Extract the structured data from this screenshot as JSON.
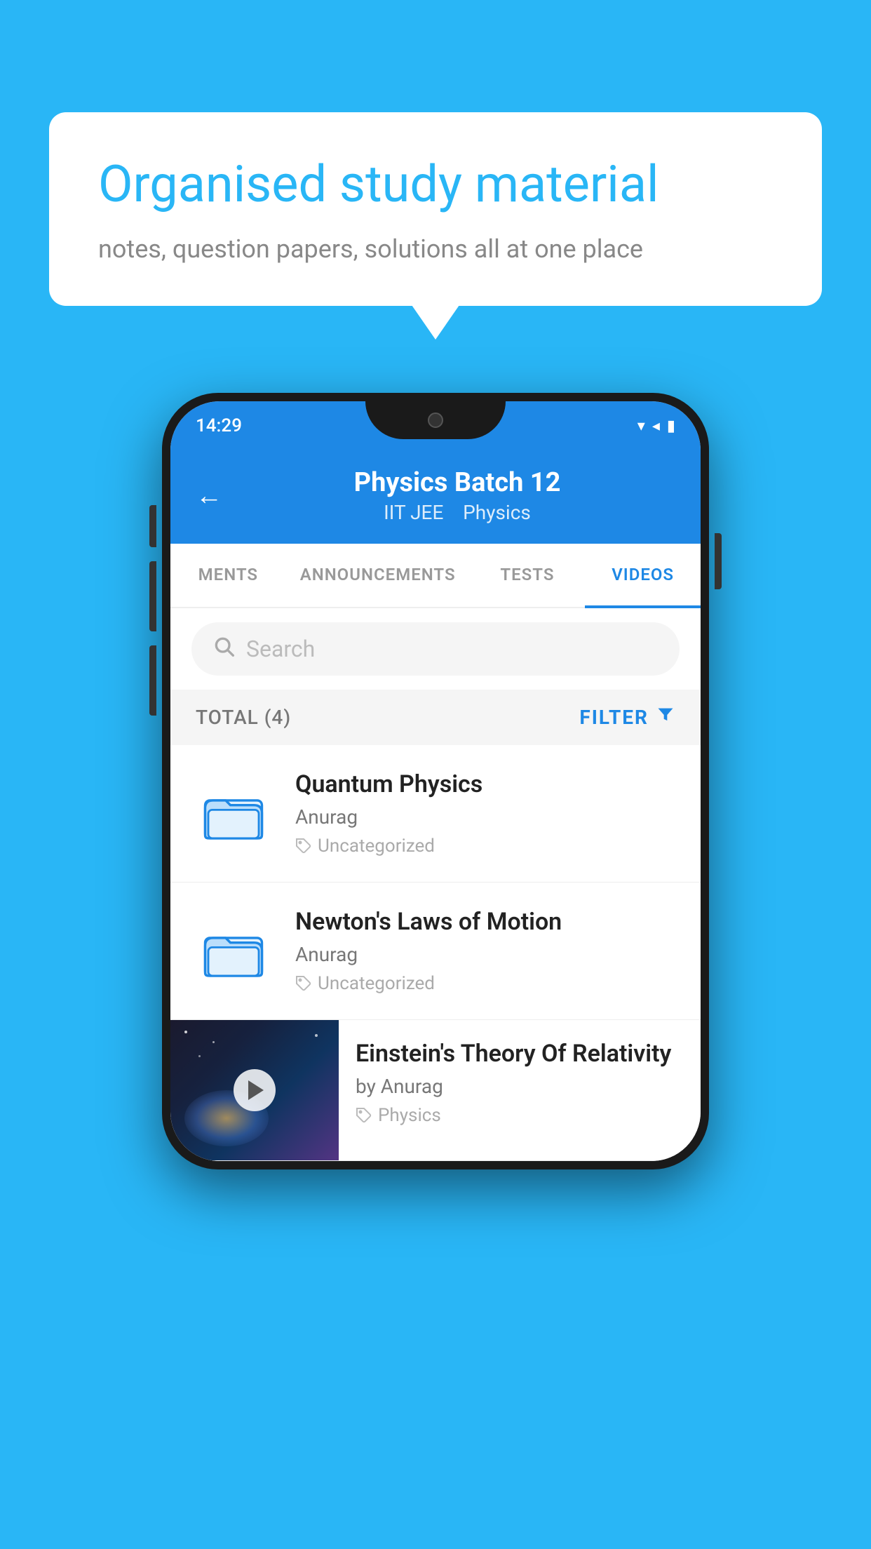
{
  "background_color": "#29b6f6",
  "bubble": {
    "title": "Organised study material",
    "subtitle": "notes, question papers, solutions all at one place"
  },
  "status_bar": {
    "time": "14:29",
    "icons": "▾ ◂ ▮"
  },
  "app_header": {
    "back_label": "←",
    "title": "Physics Batch 12",
    "subtitle_part1": "IIT JEE",
    "subtitle_part2": "Physics"
  },
  "tabs": [
    {
      "label": "MENTS",
      "active": false
    },
    {
      "label": "ANNOUNCEMENTS",
      "active": false
    },
    {
      "label": "TESTS",
      "active": false
    },
    {
      "label": "VIDEOS",
      "active": true
    }
  ],
  "search": {
    "placeholder": "Search"
  },
  "filter_row": {
    "total_label": "TOTAL (4)",
    "filter_label": "FILTER"
  },
  "videos": [
    {
      "title": "Quantum Physics",
      "author": "Anurag",
      "tag": "Uncategorized",
      "has_thumbnail": false
    },
    {
      "title": "Newton's Laws of Motion",
      "author": "Anurag",
      "tag": "Uncategorized",
      "has_thumbnail": false
    },
    {
      "title": "Einstein's Theory Of Relativity",
      "author": "by Anurag",
      "tag": "Physics",
      "has_thumbnail": true
    }
  ]
}
